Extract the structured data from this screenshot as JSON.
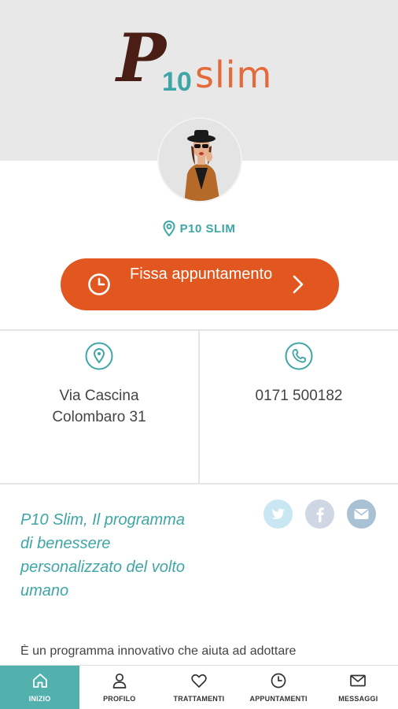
{
  "brand": {
    "logo_letter": "P",
    "logo_number": "10",
    "logo_word": "slim",
    "colors": {
      "dark": "#4a1e14",
      "teal": "#3ea6a6",
      "orange": "#e46a3a"
    }
  },
  "profile": {
    "avatar_icon": "person-photo",
    "location_icon": "map-pin-icon",
    "location_label": "P10 SLIM"
  },
  "cta": {
    "label": "Fissa appuntamento",
    "icon": "clock-icon",
    "chevron": "chevron-right-icon",
    "color": "#e2571f"
  },
  "contact": {
    "address": "Via Cascina Colombaro 31",
    "phone": "0171 500182"
  },
  "about": {
    "tagline": "P10 Slim, Il programma di benessere personalizzato del volto umano",
    "body": "È un programma innovativo che aiuta ad adottare"
  },
  "social": [
    {
      "name": "twitter",
      "color": "#c9e7f3"
    },
    {
      "name": "facebook",
      "color": "#cfd6e4"
    },
    {
      "name": "email",
      "color": "#a9c1d4"
    }
  ],
  "tabs": [
    {
      "label": "INIZIO",
      "icon": "home-icon",
      "active": true
    },
    {
      "label": "PROFILO",
      "icon": "user-icon",
      "active": false
    },
    {
      "label": "TRATTAMENTI",
      "icon": "heart-icon",
      "active": false
    },
    {
      "label": "APPUNTAMENTI",
      "icon": "clock-icon",
      "active": false
    },
    {
      "label": "MESSAGGI",
      "icon": "mail-icon",
      "active": false
    }
  ]
}
